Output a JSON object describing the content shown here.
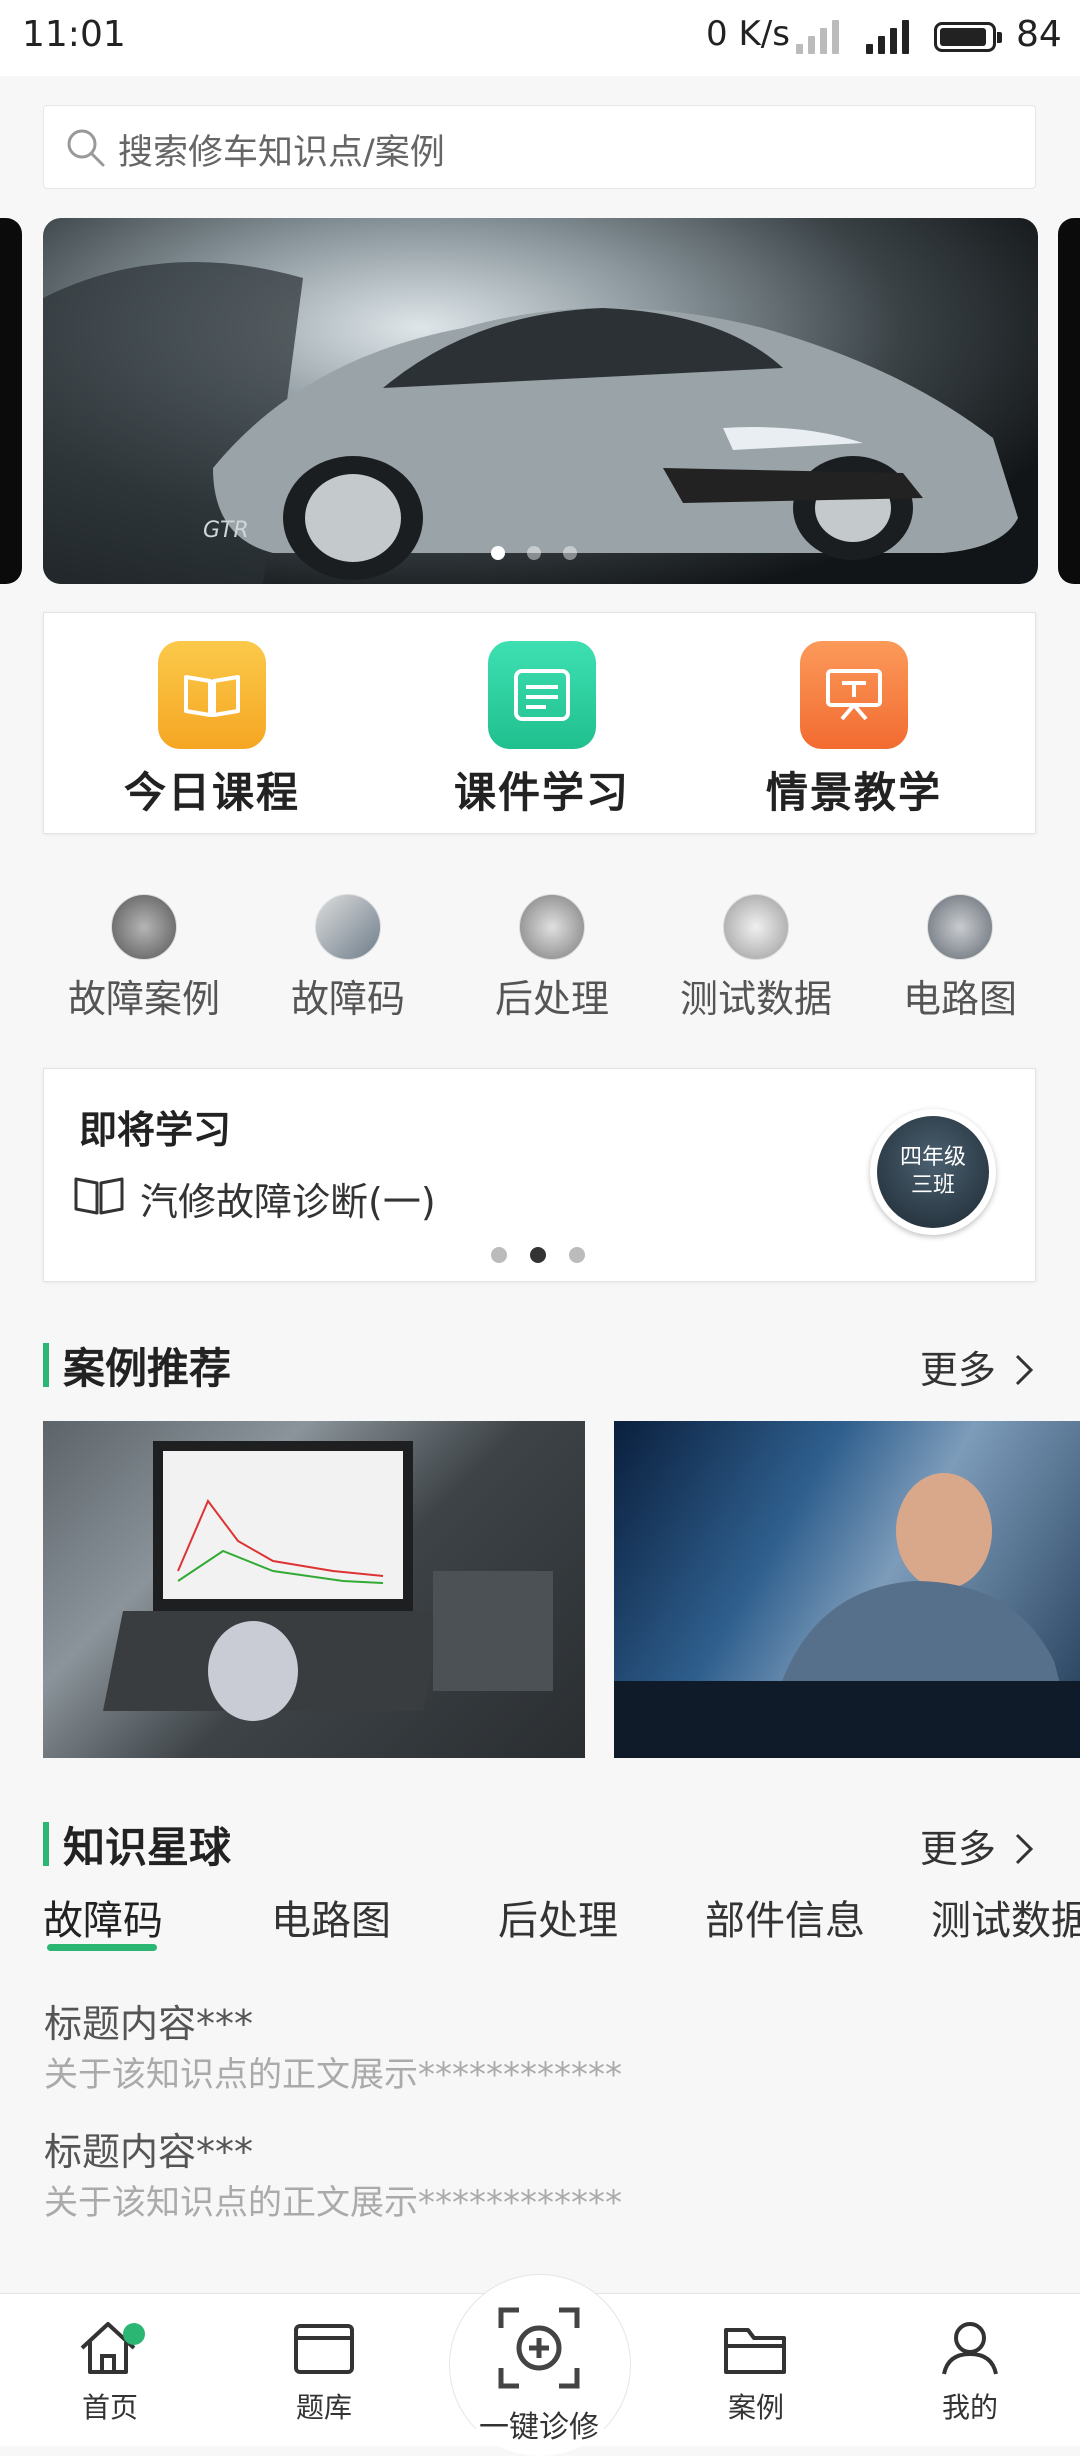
{
  "status_bar": {
    "time": "11:01",
    "net_speed": "0 K/s",
    "battery": "84"
  },
  "search": {
    "placeholder": "搜索修车知识点/案例"
  },
  "banner": {
    "slides": 3,
    "active_slide": 1,
    "brand_text": "GTR"
  },
  "features": [
    {
      "label": "今日课程",
      "icon": "book-icon",
      "color": "#f7b733"
    },
    {
      "label": "课件学习",
      "icon": "document-icon",
      "color": "#2dcfa0"
    },
    {
      "label": "情景教学",
      "icon": "presentation-icon",
      "color": "#f6773f"
    }
  ],
  "quick_links": [
    {
      "label": "故障案例"
    },
    {
      "label": "故障码"
    },
    {
      "label": "后处理"
    },
    {
      "label": "测试数据"
    },
    {
      "label": "电路图"
    }
  ],
  "upcoming": {
    "title": "即将学习",
    "course": "汽修故障诊断(一)",
    "class_badge_line1": "四年级",
    "class_badge_line2": "三班",
    "pages": 3,
    "active_page": 2
  },
  "case_section": {
    "title": "案例推荐",
    "more": "更多"
  },
  "knowledge_section": {
    "title": "知识星球",
    "more": "更多",
    "tabs": [
      "故障码",
      "电路图",
      "后处理",
      "部件信息",
      "测试数据"
    ],
    "active_tab": 0,
    "items": [
      {
        "title": "标题内容***",
        "desc": "关于该知识点的正文展示************"
      },
      {
        "title": "标题内容***",
        "desc": "关于该知识点的正文展示************"
      }
    ]
  },
  "bottom_nav": [
    {
      "label": "首页",
      "icon": "home-icon",
      "active": true
    },
    {
      "label": "题库",
      "icon": "question-bank-icon"
    },
    {
      "label": "一键诊修",
      "icon": "diagnose-scan-icon"
    },
    {
      "label": "案例",
      "icon": "folder-icon"
    },
    {
      "label": "我的",
      "icon": "user-icon"
    }
  ],
  "colors": {
    "accent": "#2bb673",
    "yellow": "#f7b733",
    "teal": "#2dcfa0",
    "orange": "#f6773f"
  }
}
